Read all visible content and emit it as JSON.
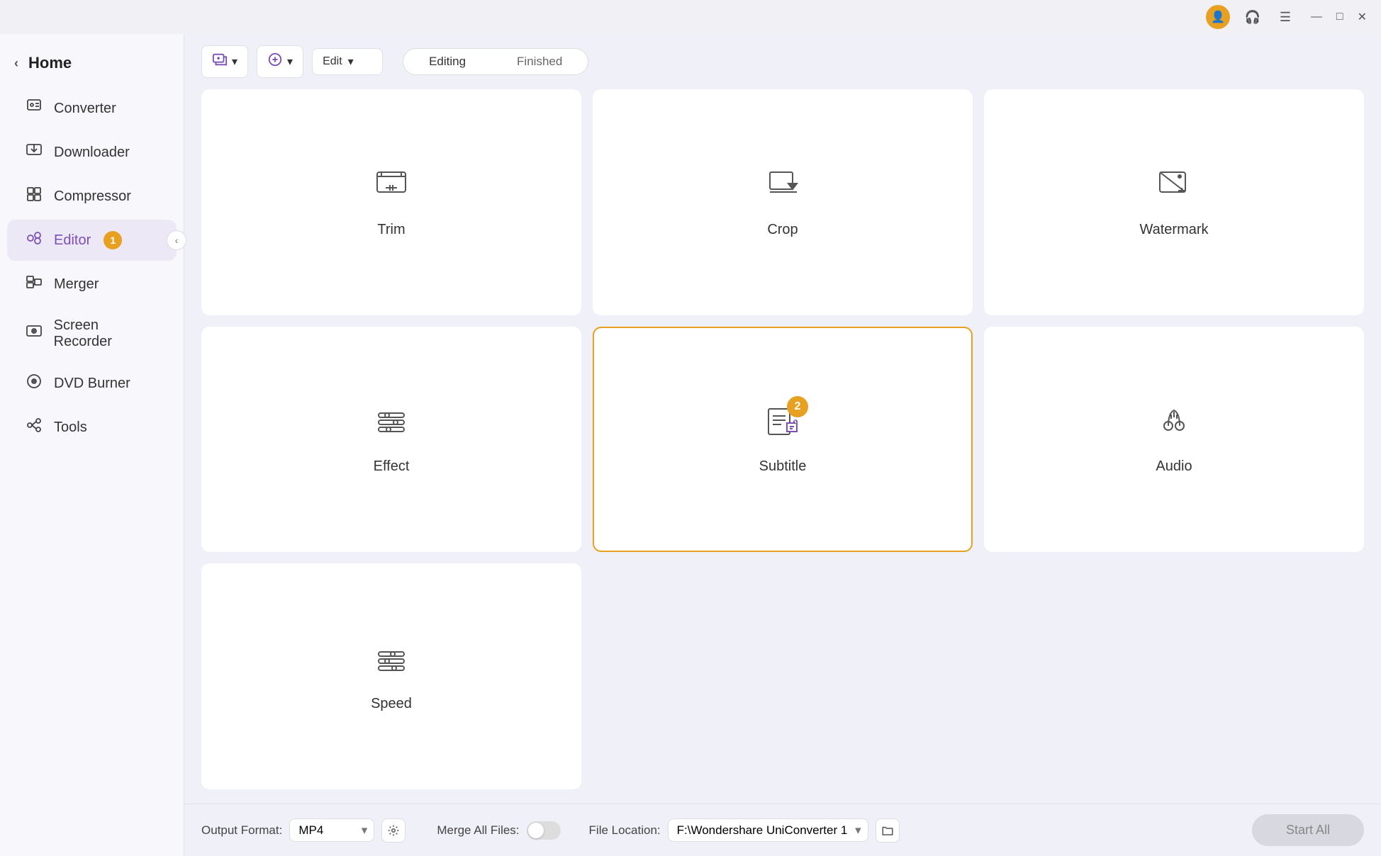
{
  "titlebar": {
    "avatar_icon": "👤",
    "notification_icon": "🎧",
    "menu_icon": "☰",
    "minimize_icon": "—",
    "maximize_icon": "□",
    "close_icon": "✕"
  },
  "sidebar": {
    "home_label": "Home",
    "collapse_icon": "‹",
    "items": [
      {
        "id": "converter",
        "label": "Converter",
        "icon": "⊙",
        "active": false,
        "badge": null
      },
      {
        "id": "downloader",
        "label": "Downloader",
        "icon": "⬇",
        "active": false,
        "badge": null
      },
      {
        "id": "compressor",
        "label": "Compressor",
        "icon": "⊞",
        "active": false,
        "badge": null
      },
      {
        "id": "editor",
        "label": "Editor",
        "icon": "✦",
        "active": true,
        "badge": "1"
      },
      {
        "id": "merger",
        "label": "Merger",
        "icon": "⧉",
        "active": false,
        "badge": null
      },
      {
        "id": "screen-recorder",
        "label": "Screen Recorder",
        "icon": "⊙",
        "active": false,
        "badge": null
      },
      {
        "id": "dvd-burner",
        "label": "DVD Burner",
        "icon": "⊙",
        "active": false,
        "badge": null
      },
      {
        "id": "tools",
        "label": "Tools",
        "icon": "⚙",
        "active": false,
        "badge": null
      }
    ]
  },
  "toolbar": {
    "add_file_btn": "Add File",
    "add_more_btn": "Add More",
    "edit_dropdown": "Edit",
    "tabs": [
      {
        "id": "editing",
        "label": "Editing",
        "active": true
      },
      {
        "id": "finished",
        "label": "Finished",
        "active": false
      }
    ]
  },
  "editor_cards": [
    {
      "id": "trim",
      "label": "Trim",
      "selected": false,
      "badge": null
    },
    {
      "id": "crop",
      "label": "Crop",
      "selected": false,
      "badge": null
    },
    {
      "id": "watermark",
      "label": "Watermark",
      "selected": false,
      "badge": null
    },
    {
      "id": "effect",
      "label": "Effect",
      "selected": false,
      "badge": null
    },
    {
      "id": "subtitle",
      "label": "Subtitle",
      "selected": true,
      "badge": "2"
    },
    {
      "id": "audio",
      "label": "Audio",
      "selected": false,
      "badge": null
    },
    {
      "id": "speed",
      "label": "Speed",
      "selected": false,
      "badge": null
    }
  ],
  "bottombar": {
    "output_format_label": "Output Format:",
    "output_format_value": "MP4",
    "merge_all_label": "Merge All Files:",
    "file_location_label": "File Location:",
    "file_location_value": "F:\\Wondershare UniConverter 1",
    "start_all_btn": "Start All"
  }
}
